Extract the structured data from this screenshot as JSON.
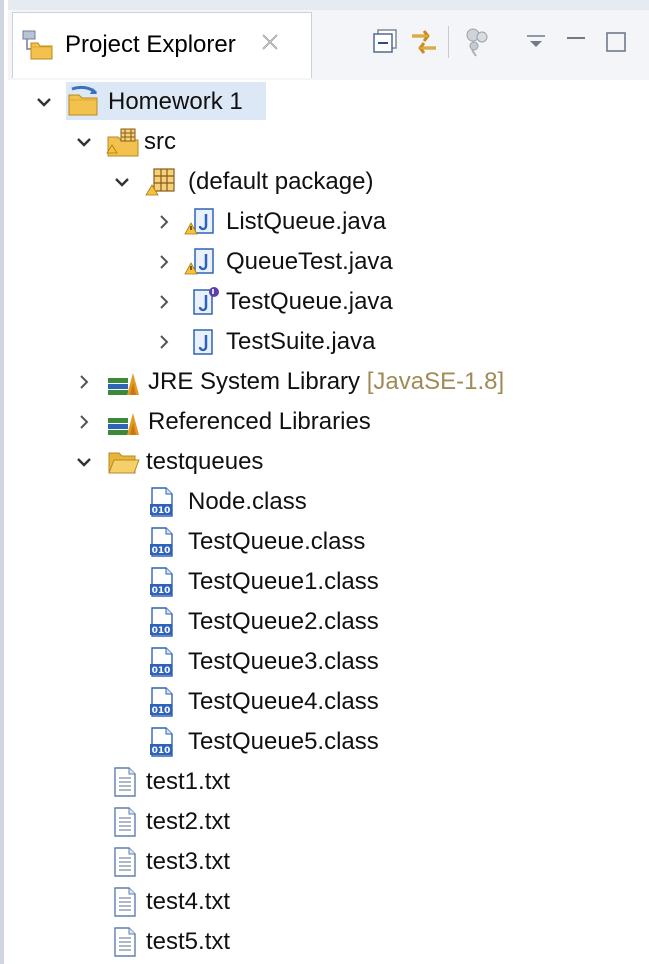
{
  "view": {
    "tab_label": "Project Explorer",
    "icons": {
      "tab": "project-explorer-icon",
      "close": "close-icon",
      "collapse_all": "collapse-all-icon",
      "link_with_editor": "link-with-editor-icon",
      "filters": "filters-icon",
      "view_menu": "view-menu-icon",
      "minimize": "minimize-icon",
      "maximize": "maximize-icon"
    }
  },
  "tree": {
    "project": {
      "label": "Homework 1",
      "expanded": true,
      "selected": true
    },
    "src": {
      "label": "src",
      "expanded": true
    },
    "default_package": {
      "label": "(default package)",
      "expanded": true
    },
    "java_files": [
      {
        "label": "ListQueue.java",
        "warning": true
      },
      {
        "label": "QueueTest.java",
        "warning": true
      },
      {
        "label": "TestQueue.java",
        "warning": false
      },
      {
        "label": "TestSuite.java",
        "warning": false
      }
    ],
    "jre": {
      "label": "JRE System Library",
      "decoration": "[JavaSE-1.8]"
    },
    "referenced": {
      "label": "Referenced Libraries"
    },
    "testqueues": {
      "label": "testqueues",
      "expanded": true
    },
    "class_files": [
      "Node.class",
      "TestQueue.class",
      "TestQueue1.class",
      "TestQueue2.class",
      "TestQueue3.class",
      "TestQueue4.class",
      "TestQueue5.class"
    ],
    "text_files": [
      "test1.txt",
      "test2.txt",
      "test3.txt",
      "test4.txt",
      "test5.txt"
    ]
  },
  "colors": {
    "selection": "#dde8f6",
    "decoration_text": "#a08a55",
    "folder": "#f2c14e",
    "java_blue": "#2e63b8"
  }
}
